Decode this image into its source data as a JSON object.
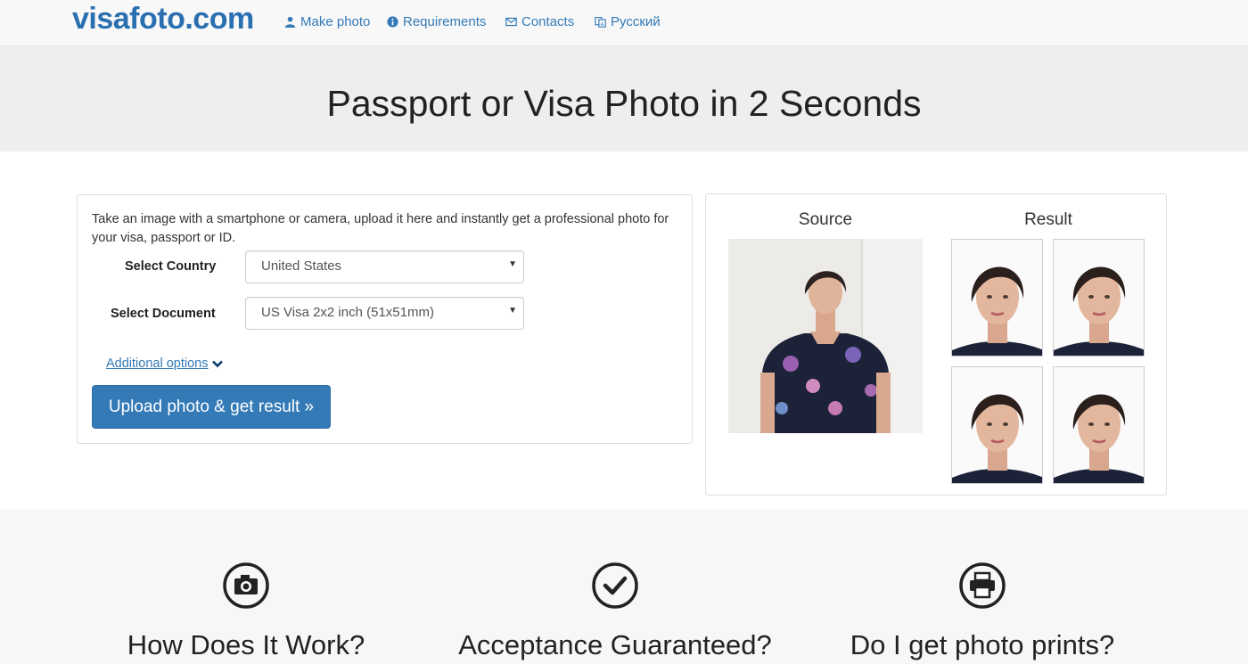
{
  "navbar": {
    "brand": "visafoto.com",
    "items": [
      {
        "label": "Make photo",
        "icon": "user-icon"
      },
      {
        "label": "Requirements",
        "icon": "info-circle-icon"
      },
      {
        "label": "Contacts",
        "icon": "envelope-icon"
      },
      {
        "label": "Русский",
        "icon": "language-icon"
      }
    ]
  },
  "hero": {
    "title": "Passport or Visa Photo in 2 Seconds"
  },
  "form": {
    "intro": "Take an image with a smartphone or camera, upload it here and instantly get a professional photo for your visa, passport or ID.",
    "country_label": "Select Country",
    "country_value": "United States",
    "document_label": "Select Document",
    "document_value": "US Visa 2x2 inch (51x51mm)",
    "additional_options": "Additional options",
    "upload_button": "Upload photo & get result »"
  },
  "preview": {
    "source_label": "Source",
    "result_label": "Result"
  },
  "features": [
    {
      "title": "How Does It Work?",
      "icon": "camera-icon"
    },
    {
      "title": "Acceptance Guaranteed?",
      "icon": "check-circle-icon"
    },
    {
      "title": "Do I get photo prints?",
      "icon": "printer-icon"
    }
  ],
  "colors": {
    "brand": "#2a6fb0",
    "link": "#337ab7",
    "button": "#337ab7"
  }
}
